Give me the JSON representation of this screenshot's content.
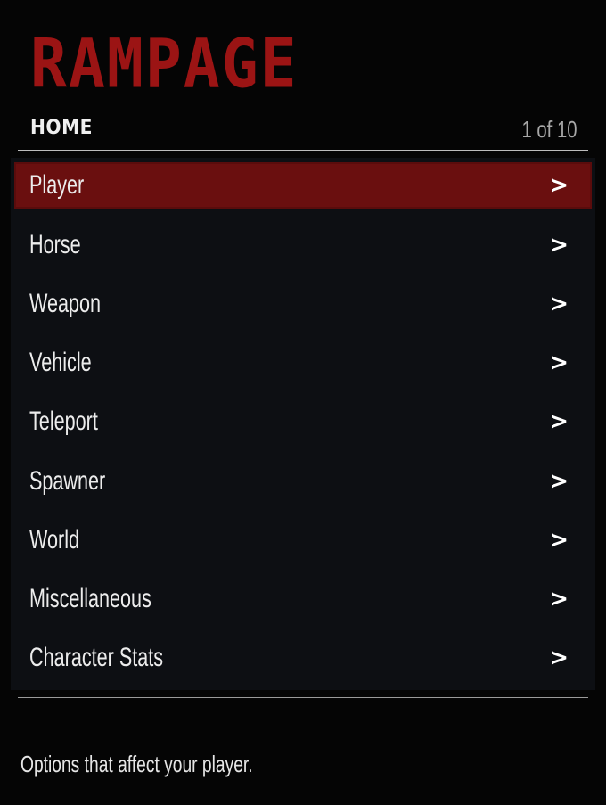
{
  "logo": {
    "text": "RAMPAGE"
  },
  "header": {
    "breadcrumb": "HOME",
    "page_counter": "1 of 10"
  },
  "menu": {
    "selected_index": 0,
    "items": [
      {
        "label": "Player",
        "arrow": ">"
      },
      {
        "label": "Horse",
        "arrow": ">"
      },
      {
        "label": "Weapon",
        "arrow": ">"
      },
      {
        "label": "Vehicle",
        "arrow": ">"
      },
      {
        "label": "Teleport",
        "arrow": ">"
      },
      {
        "label": "Spawner",
        "arrow": ">"
      },
      {
        "label": "World",
        "arrow": ">"
      },
      {
        "label": "Miscellaneous",
        "arrow": ">"
      },
      {
        "label": "Character Stats",
        "arrow": ">"
      }
    ]
  },
  "footer": {
    "description": "Options that affect your player."
  },
  "colors": {
    "accent": "#9b1414",
    "selection": "#6a0f0f",
    "panel": "#0d0f13",
    "background": "#050505"
  }
}
